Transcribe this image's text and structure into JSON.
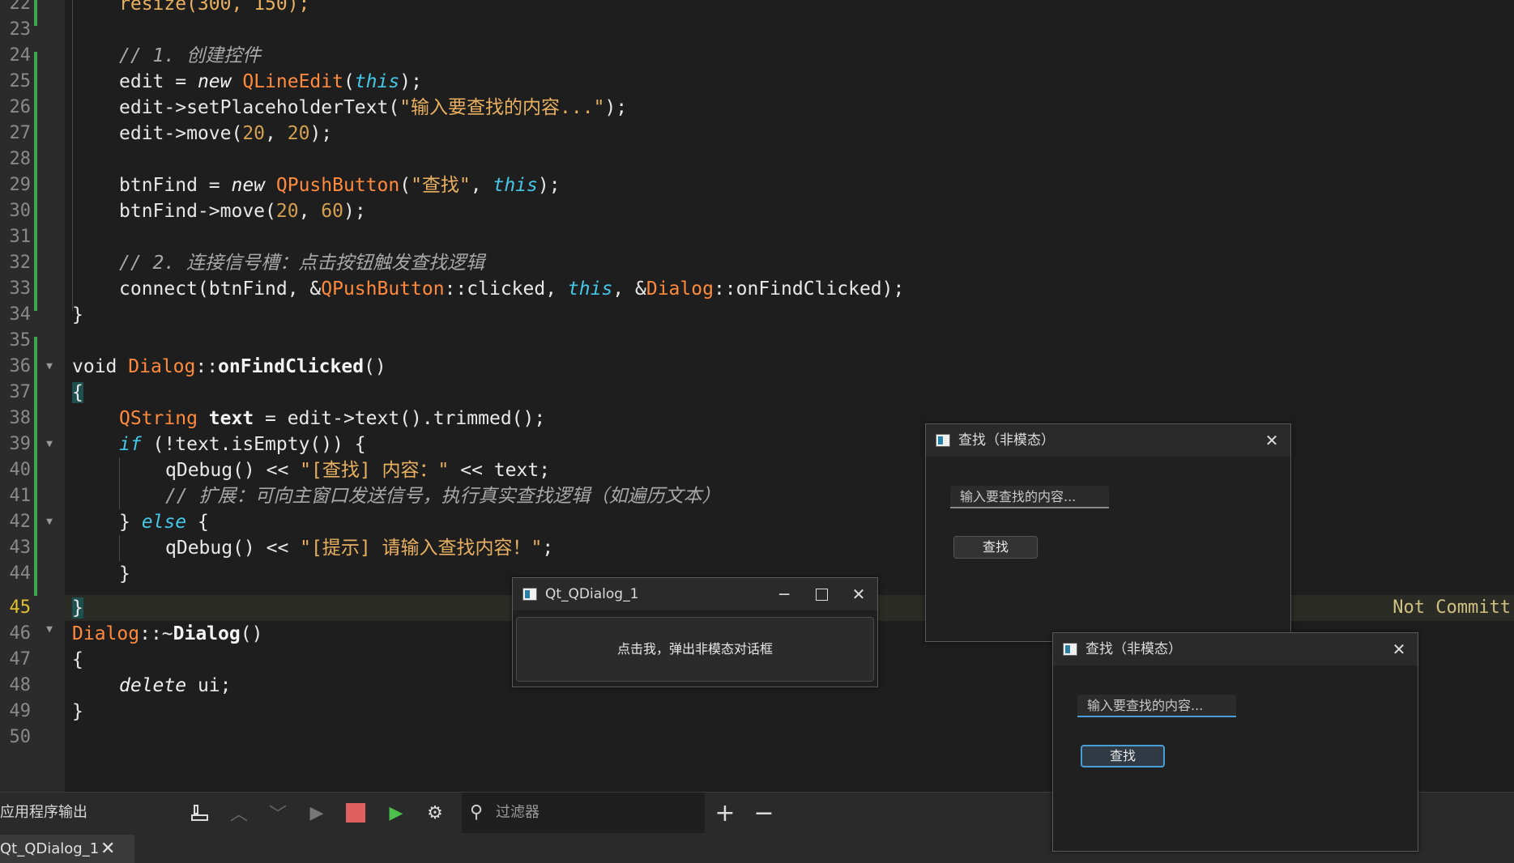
{
  "editor": {
    "line_numbers": [
      "22",
      "23",
      "24",
      "25",
      "26",
      "27",
      "28",
      "29",
      "30",
      "31",
      "32",
      "33",
      "34",
      "35",
      "36",
      "37",
      "38",
      "39",
      "40",
      "41",
      "42",
      "43",
      "44",
      "45",
      "46",
      "47",
      "48",
      "49",
      "50"
    ],
    "current_line": "45",
    "lines": {
      "l22": "resize(300, 150);",
      "l24": "// 1. 创建控件",
      "l25_a": "edit = ",
      "l25_new": "new",
      "l25_ty": "QLineEdit",
      "l25_this": "this",
      "l25_end": ");",
      "l25_op": "(",
      "l26_a": "edit->setPlaceholderText(",
      "l26_str": "\"输入要查找的内容...\"",
      "l26_end": ");",
      "l27_a": "edit->move(",
      "l27_n1": "20",
      "l27_sep": ", ",
      "l27_n2": "20",
      "l27_end": ");",
      "l29_a": "btnFind = ",
      "l29_new": "new",
      "l29_ty": "QPushButton",
      "l29_op": "(",
      "l29_str": "\"查找\"",
      "l29_sep": ", ",
      "l29_this": "this",
      "l29_end": ");",
      "l30_a": "btnFind->move(",
      "l30_n1": "20",
      "l30_sep": ", ",
      "l30_n2": "60",
      "l30_end": ");",
      "l32": "// 2. 连接信号槽：点击按钮触发查找逻辑",
      "l33_a": "connect(btnFind, &",
      "l33_ty": "QPushButton",
      "l33_b": "::clicked, ",
      "l33_this": "this",
      "l33_c": ", &",
      "l33_ty2": "Dialog",
      "l33_d": "::onFindClicked);",
      "l34": "}",
      "l36_a": "void ",
      "l36_ty": "Dialog",
      "l36_sep": "::",
      "l36_fn": "onFindClicked",
      "l36_end": "()",
      "l37": "{",
      "l38_ty": "QString",
      "l38_sp": " ",
      "l38_var": "text",
      "l38_b": " = edit->text().trimmed();",
      "l39_kw": "if",
      "l39_b": " (!text.isEmpty()) {",
      "l40_a": "qDebug() << ",
      "l40_str": "\"[查找] 内容：\"",
      "l40_b": " << text;",
      "l41": "// 扩展：可向主窗口发送信号，执行真实查找逻辑（如遍历文本）",
      "l42_a": "} ",
      "l42_kw": "else",
      "l42_b": " {",
      "l43_a": "qDebug() << ",
      "l43_str": "\"[提示] 请输入查找内容！\"",
      "l43_b": ";",
      "l44": "}",
      "l45": "}",
      "l46_ty": "Dialog",
      "l46_a": "::~",
      "l46_fn": "Dialog",
      "l46_end": "()",
      "l47": "{",
      "l48_kw": "delete",
      "l48_b": " ui;",
      "l49": "}"
    },
    "status_not_committed": "Not Committ"
  },
  "bottom_panel": {
    "title": "应用程序输出",
    "filter_placeholder": "过滤器",
    "tab_label": "Qt_QDialog_1",
    "tab_close": "✕"
  },
  "main_window": {
    "title": "Qt_QDialog_1",
    "button_label": "点击我，弹出非模态对话框"
  },
  "find_dialog_1": {
    "title": "查找（非模态）",
    "placeholder": "输入要查找的内容...",
    "button_label": "查找"
  },
  "find_dialog_2": {
    "title": "查找（非模态）",
    "placeholder": "输入要查找的内容...",
    "button_label": "查找"
  },
  "colors": {
    "keyword_this": "#45c8e8",
    "type": "#ff8a3d",
    "string": "#e8b060",
    "number": "#d4a050",
    "comment": "#a8a8a8",
    "accent": "#4a9ed8"
  }
}
